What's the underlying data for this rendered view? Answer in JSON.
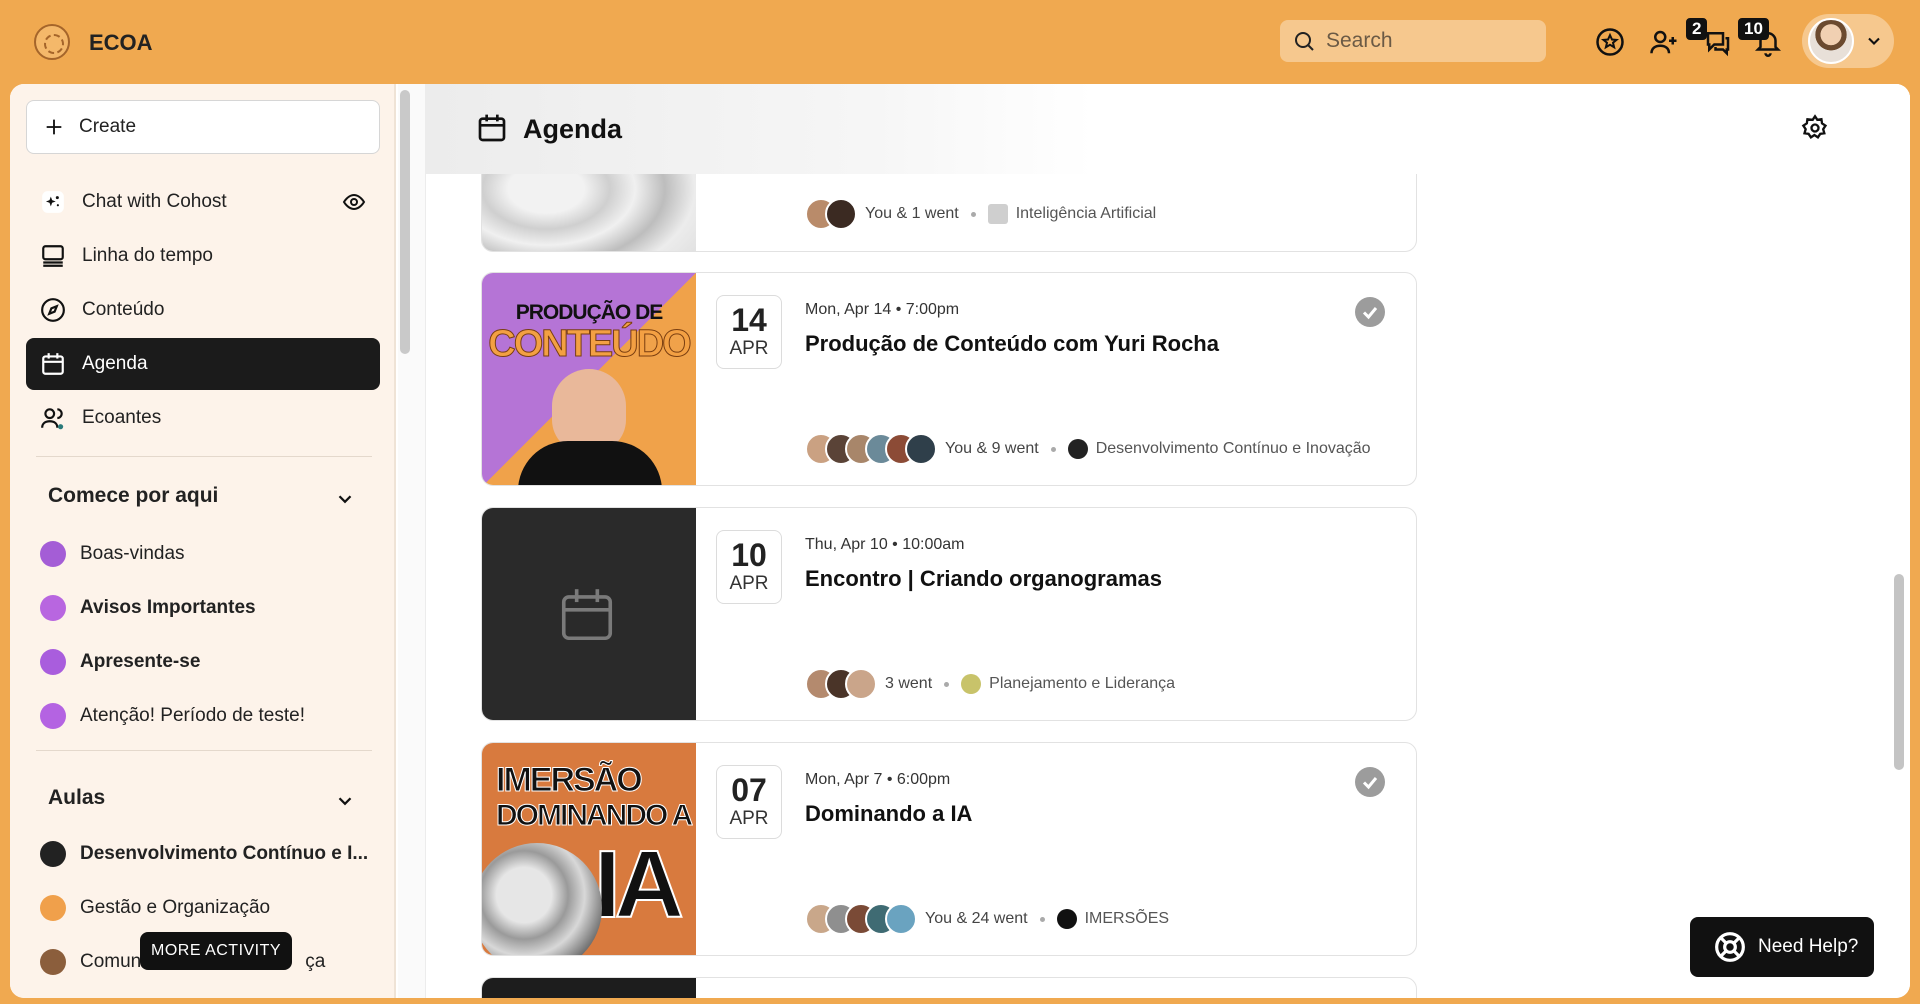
{
  "app": {
    "brand": "ECOA"
  },
  "topbar": {
    "search_placeholder": "Search",
    "badge_requests": "2",
    "badge_notifications": "10"
  },
  "sidebar": {
    "create_label": "Create",
    "nav": [
      {
        "label": "Chat with Cohost"
      },
      {
        "label": "Linha do tempo"
      },
      {
        "label": "Conteúdo"
      },
      {
        "label": "Agenda"
      },
      {
        "label": "Ecoantes"
      }
    ],
    "sections": [
      {
        "title": "Comece por aqui",
        "items": [
          {
            "label": "Boas-vindas",
            "color": "#a45dd6"
          },
          {
            "label": "Avisos Importantes",
            "color": "#b866e0"
          },
          {
            "label": "Apresente-se",
            "color": "#a95ddd"
          },
          {
            "label": "Atenção! Período de teste!",
            "color": "#b463e2"
          }
        ]
      },
      {
        "title": "Aulas",
        "items": [
          {
            "label": "Desenvolvimento Contínuo e I...",
            "color": "#222222"
          },
          {
            "label": "Gestão e Organização",
            "color": "#f0a04b"
          },
          {
            "label": "Comunicação e Liderança",
            "visible_prefix": "Comun",
            "visible_suffix": "ça",
            "color": "#8b5e3c"
          }
        ]
      }
    ],
    "tooltip": "MORE ACTIVITY"
  },
  "main": {
    "title": "Agenda",
    "events": [
      {
        "partial": true,
        "attendance": "You & 1 went",
        "space": "Inteligência Artificial"
      },
      {
        "day": "14",
        "month": "APR",
        "when": "Mon, Apr 14 • 7:00pm",
        "title": "Produção de Conteúdo com Yuri Rocha",
        "attendance": "You & 9 went",
        "space": "Desenvolvimento Contínuo e Inovação",
        "thumb_text_1": "PRODUÇÃO DE",
        "thumb_text_2": "CONTEÚDO",
        "checked": true
      },
      {
        "day": "10",
        "month": "APR",
        "when": "Thu, Apr 10 • 10:00am",
        "title": "Encontro | Criando organogramas",
        "attendance": "3 went",
        "space": "Planejamento e Liderança",
        "checked": false
      },
      {
        "day": "07",
        "month": "APR",
        "when": "Mon, Apr 7 • 6:00pm",
        "title": "Dominando a IA",
        "attendance": "You & 24 went",
        "space": "IMERSÕES",
        "thumb_text_1": "IMERSÃO",
        "thumb_text_2": "DOMINANDO A",
        "thumb_text_3": "IA",
        "checked": true
      }
    ]
  },
  "help": {
    "label": "Need Help?"
  },
  "colors": {
    "accent": "#F0A950",
    "active_nav": "#1b1b1b",
    "sidebar_bg": "#FDF3EA"
  }
}
